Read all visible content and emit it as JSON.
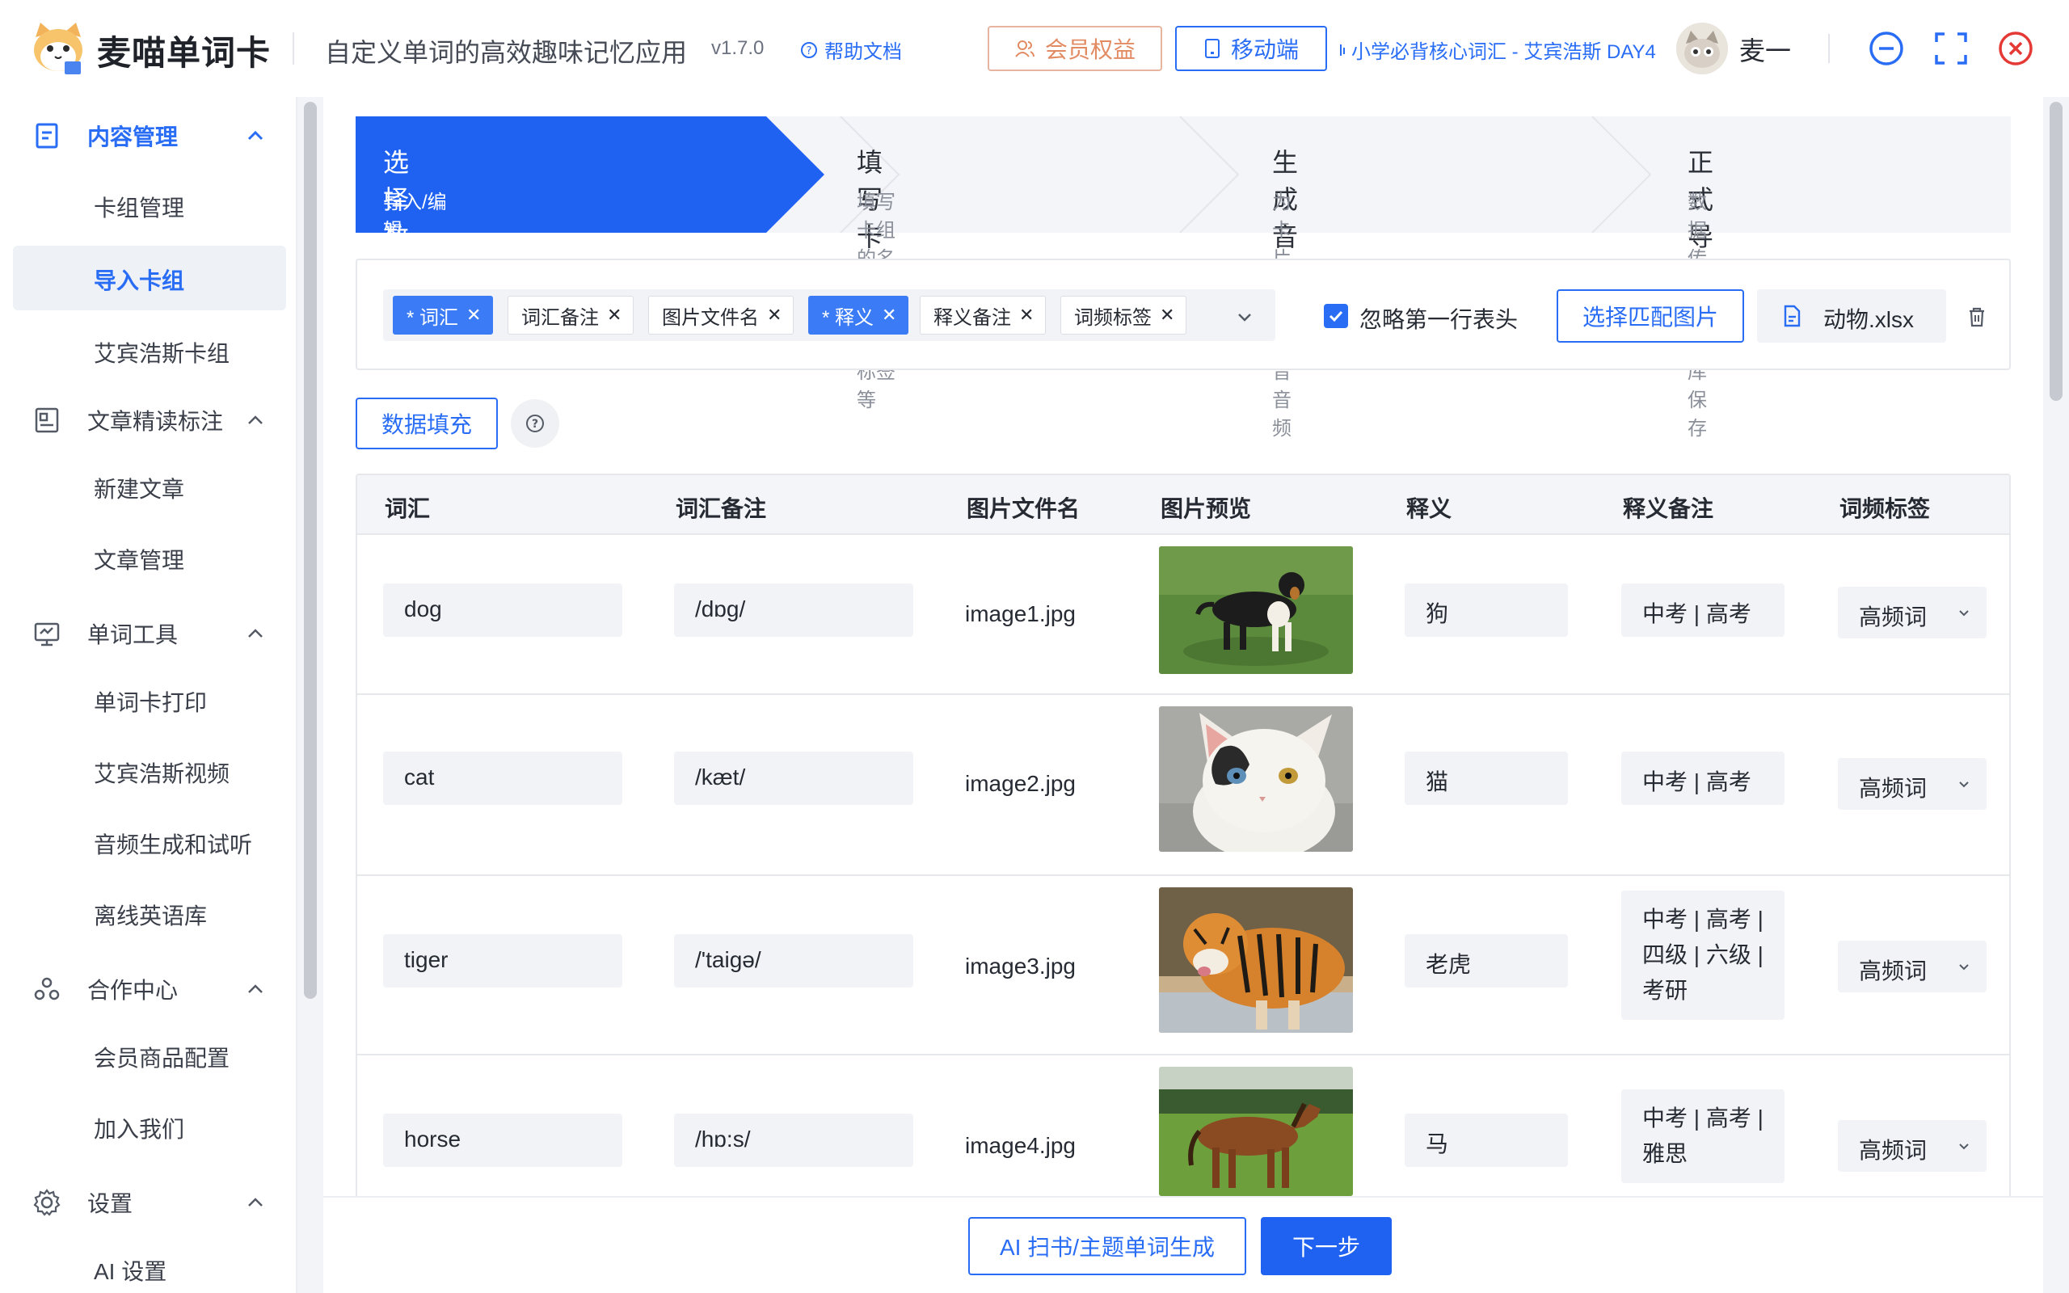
{
  "app": {
    "name": "麦喵单词卡",
    "slogan": "自定义单词的高效趣味记忆应用",
    "version": "v1.7.0",
    "help_label": "帮助文档",
    "member_label": "会员权益",
    "mobile_label": "移动端",
    "now_playing": "小学必背核心词汇 - 艾宾浩斯 DAY4",
    "user_name": "麦一"
  },
  "colors": {
    "accent": "#2a6df5",
    "member": "#e28b63",
    "close": "#e53935",
    "tag_required": "#3b7cf6"
  },
  "sidebar": {
    "groups": [
      {
        "label": "内容管理",
        "icon": "document-icon",
        "active": true,
        "items": [
          "卡组管理",
          "导入卡组",
          "艾宾浩斯卡组"
        ]
      },
      {
        "label": "文章精读标注",
        "icon": "article-icon",
        "items": [
          "新建文章",
          "文章管理"
        ]
      },
      {
        "label": "单词工具",
        "icon": "monitor-icon",
        "items": [
          "单词卡打印",
          "艾宾浩斯视频",
          "音频生成和试听",
          "离线英语库"
        ]
      },
      {
        "label": "合作中心",
        "icon": "cooperation-icon",
        "items": [
          "会员商品配置",
          "加入我们"
        ]
      },
      {
        "label": "设置",
        "icon": "gear-icon",
        "items": [
          "AI 设置"
        ]
      }
    ],
    "active_item": "导入卡组"
  },
  "steps": [
    {
      "title": "选择数据源",
      "desc": "导入/编辑 Excel/Pdf 数据和图片",
      "active": true
    },
    {
      "title": "填写卡组信息",
      "desc": "填写卡组的名称、描述、标签等"
    },
    {
      "title": "生成音频",
      "desc": "为卡片生成发音音频"
    },
    {
      "title": "正式导入",
      "desc": "数据传入数据库保存"
    }
  ],
  "columns_select": {
    "tags": [
      {
        "label": "* 词汇",
        "required": true
      },
      {
        "label": "词汇备注"
      },
      {
        "label": "图片文件名"
      },
      {
        "label": "* 释义",
        "required": true
      },
      {
        "label": "释义备注"
      },
      {
        "label": "词频标签"
      }
    ]
  },
  "options": {
    "ignore_header_label": "忽略第一行表头",
    "ignore_header_checked": true,
    "match_images_label": "选择匹配图片",
    "file_name": "动物.xlsx",
    "fill_label": "数据填充"
  },
  "table": {
    "headers": [
      "词汇",
      "词汇备注",
      "图片文件名",
      "图片预览",
      "释义",
      "释义备注",
      "词频标签"
    ],
    "rows": [
      {
        "word": "dog",
        "phonetic": "/dɒg/",
        "image_file": "image1.jpg",
        "meaning": "狗",
        "meaning_note": "中考 | 高考",
        "frequency": "高频词"
      },
      {
        "word": "cat",
        "phonetic": "/kæt/",
        "image_file": "image2.jpg",
        "meaning": "猫",
        "meaning_note": "中考 | 高考",
        "frequency": "高频词"
      },
      {
        "word": "tiger",
        "phonetic": "/'taigə/",
        "image_file": "image3.jpg",
        "meaning": "老虎",
        "meaning_note_lines": [
          "中考 | 高考 |",
          "四级 | 六级 |",
          "考研"
        ],
        "frequency": "高频词"
      },
      {
        "word": "horse",
        "phonetic": "/hɒ:s/",
        "image_file": "image4.jpg",
        "meaning": "马",
        "meaning_note_lines": [
          "中考 | 高考 |",
          "雅思"
        ],
        "frequency": "高频词"
      }
    ]
  },
  "footer": {
    "ai_label": "AI 扫书/主题单词生成",
    "next_label": "下一步"
  }
}
